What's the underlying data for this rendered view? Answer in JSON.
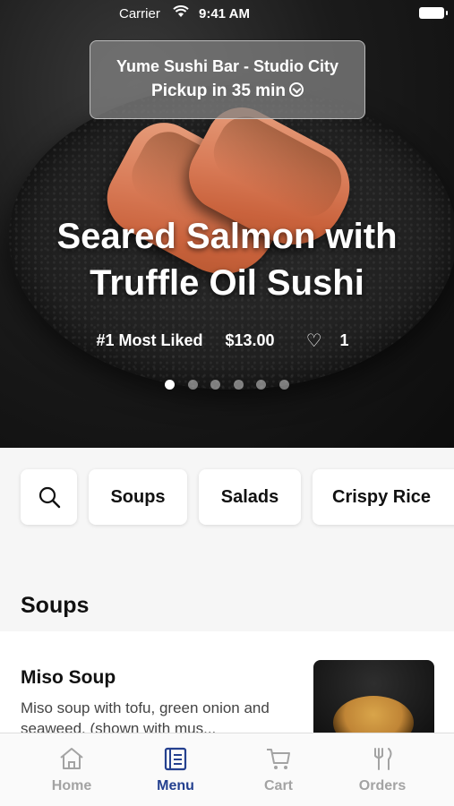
{
  "status_bar": {
    "carrier": "Carrier",
    "time": "9:41 AM"
  },
  "hero": {
    "store_name": "Yume Sushi Bar - Studio City",
    "pickup": "Pickup in 35 min",
    "title": "Seared Salmon with Truffle Oil Sushi",
    "badge": "#1 Most Liked",
    "price": "$13.00",
    "likes": "1",
    "carousel_count": 6,
    "carousel_active": 0
  },
  "categories": {
    "search_icon": "search-icon",
    "items": [
      {
        "label": "Soups"
      },
      {
        "label": "Salads"
      },
      {
        "label": "Crispy Rice"
      }
    ]
  },
  "section": {
    "title": "Soups"
  },
  "menu_items": [
    {
      "name": "Miso Soup",
      "description": "Miso soup with tofu, green onion and seaweed. (shown with mus..."
    }
  ],
  "tabbar": {
    "tabs": [
      {
        "label": "Home",
        "icon": "home-icon"
      },
      {
        "label": "Menu",
        "icon": "menu-book-icon"
      },
      {
        "label": "Cart",
        "icon": "cart-icon"
      },
      {
        "label": "Orders",
        "icon": "fork-knife-icon"
      }
    ],
    "active_index": 1,
    "active_color": "#24408f",
    "inactive_color": "#a3a3a3"
  }
}
